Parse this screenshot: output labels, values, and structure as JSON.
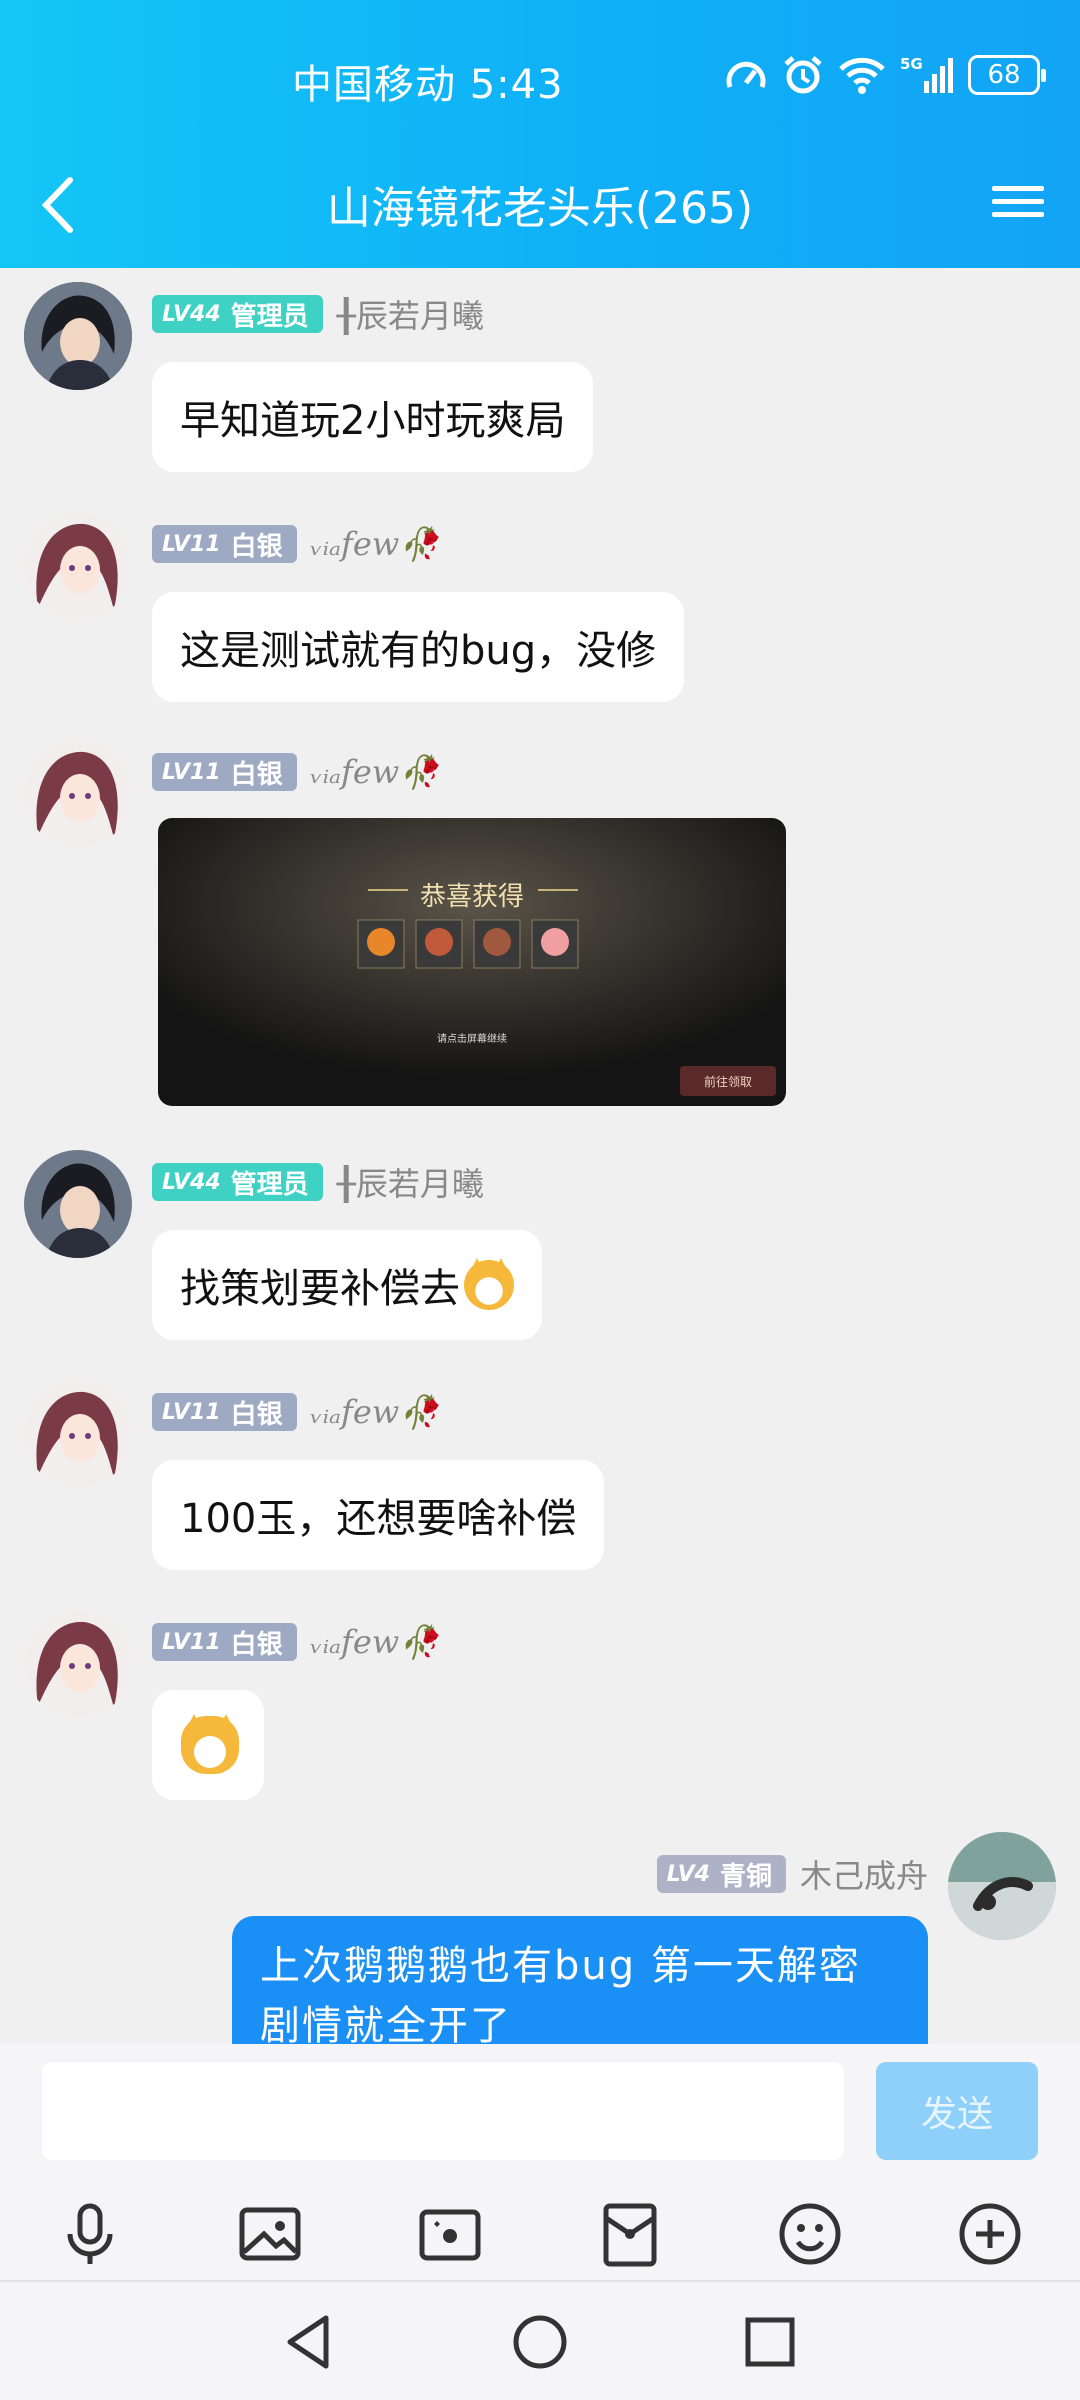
{
  "status": {
    "carrier_time": "中国移动 5:43",
    "battery": "68",
    "network": "5G"
  },
  "nav": {
    "title": "山海镜花老头乐(265)"
  },
  "messages": [
    {
      "side": "left",
      "level": "LV44",
      "role": "管理员",
      "badge": "admin",
      "nick": "╂辰若月曦",
      "type": "text",
      "text": "早知道玩2小时玩爽局"
    },
    {
      "side": "left",
      "level": "LV11",
      "role": "白银",
      "badge": "silver",
      "nick": "ᵥᵢₐfew🥀",
      "type": "text",
      "text": "这是测试就有的bug，没修"
    },
    {
      "side": "left",
      "level": "LV11",
      "role": "白银",
      "badge": "silver",
      "nick": "ᵥᵢₐfew🥀",
      "type": "image",
      "image": {
        "banner": "恭喜获得",
        "tap_hint": "请点击屏幕继续",
        "button": "前往领取"
      }
    },
    {
      "side": "left",
      "level": "LV44",
      "role": "管理员",
      "badge": "admin",
      "nick": "╂辰若月曦",
      "type": "text",
      "text": "找策划要补偿去",
      "emoji": "shiba-emoji"
    },
    {
      "side": "left",
      "level": "LV11",
      "role": "白银",
      "badge": "silver",
      "nick": "ᵥᵢₐfew🥀",
      "type": "text",
      "text": "100玉，还想要啥补偿"
    },
    {
      "side": "left",
      "level": "LV11",
      "role": "白银",
      "badge": "silver",
      "nick": "ᵥᵢₐfew🥀",
      "type": "emoji",
      "emoji": "shiba-emoji"
    },
    {
      "side": "right",
      "level": "LV4",
      "role": "青铜",
      "badge": "bronze",
      "nick": "木己成舟",
      "type": "text",
      "text": "上次鹅鹅鹅也有bug 第一天解密剧情就全开了"
    }
  ],
  "input": {
    "placeholder": "",
    "send_label": "发送"
  },
  "toolbar": [
    "mic-icon",
    "image-icon",
    "camera-icon",
    "red-packet-icon",
    "emoji-icon",
    "plus-icon"
  ],
  "colors": {
    "header": "#0fb0f7",
    "admin_badge": "#3fd1c4",
    "silver_badge": "#9ea9c4",
    "my_bubble": "#1a8ff6",
    "send_button": "#8fd0fb"
  }
}
